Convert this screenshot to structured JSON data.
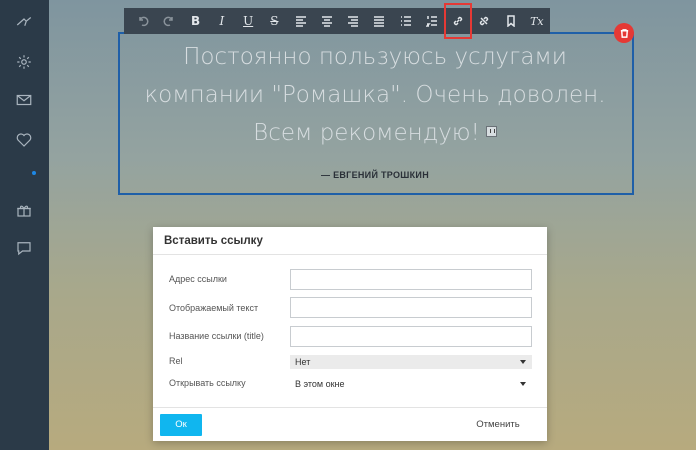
{
  "sidebar": {
    "items": [
      {
        "icon": "logo-icon"
      },
      {
        "icon": "gear-icon"
      },
      {
        "icon": "mail-icon"
      },
      {
        "icon": "heart-icon"
      },
      {
        "icon": "gift-icon"
      },
      {
        "icon": "chat-icon"
      }
    ]
  },
  "toolbar": {
    "buttons": [
      {
        "icon": "undo-icon"
      },
      {
        "icon": "redo-icon"
      },
      {
        "icon": "bold-icon",
        "glyph": "B"
      },
      {
        "icon": "italic-icon",
        "glyph": "I"
      },
      {
        "icon": "underline-icon",
        "glyph": "U"
      },
      {
        "icon": "strikethrough-icon",
        "glyph": "S"
      },
      {
        "icon": "align-left-icon"
      },
      {
        "icon": "align-center-icon"
      },
      {
        "icon": "align-right-icon"
      },
      {
        "icon": "align-justify-icon"
      },
      {
        "icon": "bullet-list-icon"
      },
      {
        "icon": "numbered-list-icon"
      },
      {
        "icon": "link-icon"
      },
      {
        "icon": "unlink-icon"
      },
      {
        "icon": "bookmark-icon"
      },
      {
        "icon": "clear-format-icon",
        "glyph": "Tx"
      }
    ],
    "active_color": "#e53935"
  },
  "editor": {
    "quote": "Постоянно пользуюсь услугами компании \"Ромашка\". Очень доволен. Всем рекомендую!",
    "author": "— ЕВГЕНИЙ ТРОШКИН",
    "border_color": "#1f5fa8"
  },
  "dialog": {
    "title": "Вставить ссылку",
    "fields": {
      "url_label": "Адрес ссылки",
      "url_value": "",
      "text_label": "Отображаемый текст",
      "text_value": "",
      "title_label": "Название ссылки (title)",
      "title_value": "",
      "rel_label": "Rel",
      "rel_value": "Нет",
      "open_label": "Открывать ссылку",
      "open_value": "В этом окне"
    },
    "ok_label": "Ок",
    "cancel_label": "Отменить",
    "ok_color": "#10b6ef"
  }
}
